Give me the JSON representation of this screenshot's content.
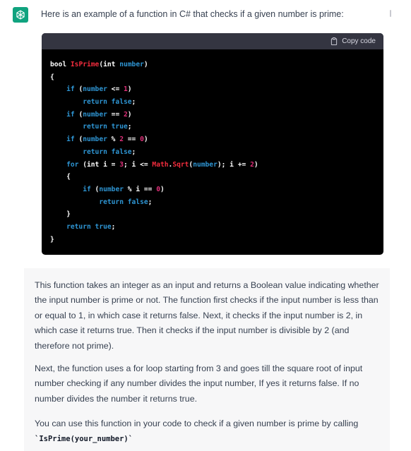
{
  "assistant": {
    "intro": "Here is an example of a function in C# that checks if a given number is prime:"
  },
  "code_block": {
    "copy_label": "Copy code",
    "lines": [
      [
        {
          "t": "bool ",
          "c": "op"
        },
        {
          "t": "IsPrime",
          "c": "fn"
        },
        {
          "t": "(int ",
          "c": "op"
        },
        {
          "t": "number",
          "c": "kw"
        },
        {
          "t": ")",
          "c": "op"
        }
      ],
      [
        {
          "t": "{",
          "c": "op"
        }
      ],
      [
        {
          "t": "    ",
          "c": "op"
        },
        {
          "t": "if",
          "c": "kw"
        },
        {
          "t": " (",
          "c": "op"
        },
        {
          "t": "number",
          "c": "kw"
        },
        {
          "t": " <= ",
          "c": "op"
        },
        {
          "t": "1",
          "c": "num"
        },
        {
          "t": ")",
          "c": "op"
        }
      ],
      [
        {
          "t": "        ",
          "c": "op"
        },
        {
          "t": "return false",
          "c": "kw"
        },
        {
          "t": ";",
          "c": "op"
        }
      ],
      [
        {
          "t": "    ",
          "c": "op"
        },
        {
          "t": "if",
          "c": "kw"
        },
        {
          "t": " (",
          "c": "op"
        },
        {
          "t": "number",
          "c": "kw"
        },
        {
          "t": " == ",
          "c": "op"
        },
        {
          "t": "2",
          "c": "num"
        },
        {
          "t": ")",
          "c": "op"
        }
      ],
      [
        {
          "t": "        ",
          "c": "op"
        },
        {
          "t": "return true",
          "c": "kw"
        },
        {
          "t": ";",
          "c": "op"
        }
      ],
      [
        {
          "t": "    ",
          "c": "op"
        },
        {
          "t": "if",
          "c": "kw"
        },
        {
          "t": " (",
          "c": "op"
        },
        {
          "t": "number",
          "c": "kw"
        },
        {
          "t": " % ",
          "c": "op"
        },
        {
          "t": "2",
          "c": "num"
        },
        {
          "t": " == ",
          "c": "op"
        },
        {
          "t": "0",
          "c": "num"
        },
        {
          "t": ")",
          "c": "op"
        }
      ],
      [
        {
          "t": "        ",
          "c": "op"
        },
        {
          "t": "return false",
          "c": "kw"
        },
        {
          "t": ";",
          "c": "op"
        }
      ],
      [
        {
          "t": "    ",
          "c": "op"
        },
        {
          "t": "for",
          "c": "kw"
        },
        {
          "t": " (int i = ",
          "c": "op"
        },
        {
          "t": "3",
          "c": "num"
        },
        {
          "t": "; i <= ",
          "c": "op"
        },
        {
          "t": "Math",
          "c": "fn"
        },
        {
          "t": ".",
          "c": "op"
        },
        {
          "t": "Sqrt",
          "c": "fn"
        },
        {
          "t": "(",
          "c": "op"
        },
        {
          "t": "number",
          "c": "kw"
        },
        {
          "t": "); i += ",
          "c": "op"
        },
        {
          "t": "2",
          "c": "num"
        },
        {
          "t": ")",
          "c": "op"
        }
      ],
      [
        {
          "t": "    {",
          "c": "op"
        }
      ],
      [
        {
          "t": "        ",
          "c": "op"
        },
        {
          "t": "if",
          "c": "kw"
        },
        {
          "t": " (",
          "c": "op"
        },
        {
          "t": "number",
          "c": "kw"
        },
        {
          "t": " % i == ",
          "c": "op"
        },
        {
          "t": "0",
          "c": "num"
        },
        {
          "t": ")",
          "c": "op"
        }
      ],
      [
        {
          "t": "            ",
          "c": "op"
        },
        {
          "t": "return false",
          "c": "kw"
        },
        {
          "t": ";",
          "c": "op"
        }
      ],
      [
        {
          "t": "    }",
          "c": "op"
        }
      ],
      [
        {
          "t": "    ",
          "c": "op"
        },
        {
          "t": "return true",
          "c": "kw"
        },
        {
          "t": ";",
          "c": "op"
        }
      ],
      [
        {
          "t": "}",
          "c": "op"
        }
      ]
    ]
  },
  "explanation": {
    "p1": "This function takes an integer as an input and returns a Boolean value indicating whether the input number is prime or not. The function first checks if the input number is less than or equal to 1, in which case it returns false. Next, it checks if the input number is 2, in which case it returns true. Then it checks if the input number is divisible by 2 (and therefore not prime).",
    "p2": "Next, the function uses a for loop starting from 3 and goes till the square root of input number checking if any number divides the input number, If yes it returns false. If no number divides the number it returns true.",
    "p3": "You can use this function in your code to check if a given number is prime by calling",
    "p3_code": "`IsPrime(your_number)`"
  },
  "colors": {
    "keyword": "#2e95d3",
    "function": "#f22c3d",
    "number": "#df3079",
    "brand": "#10a37f"
  }
}
